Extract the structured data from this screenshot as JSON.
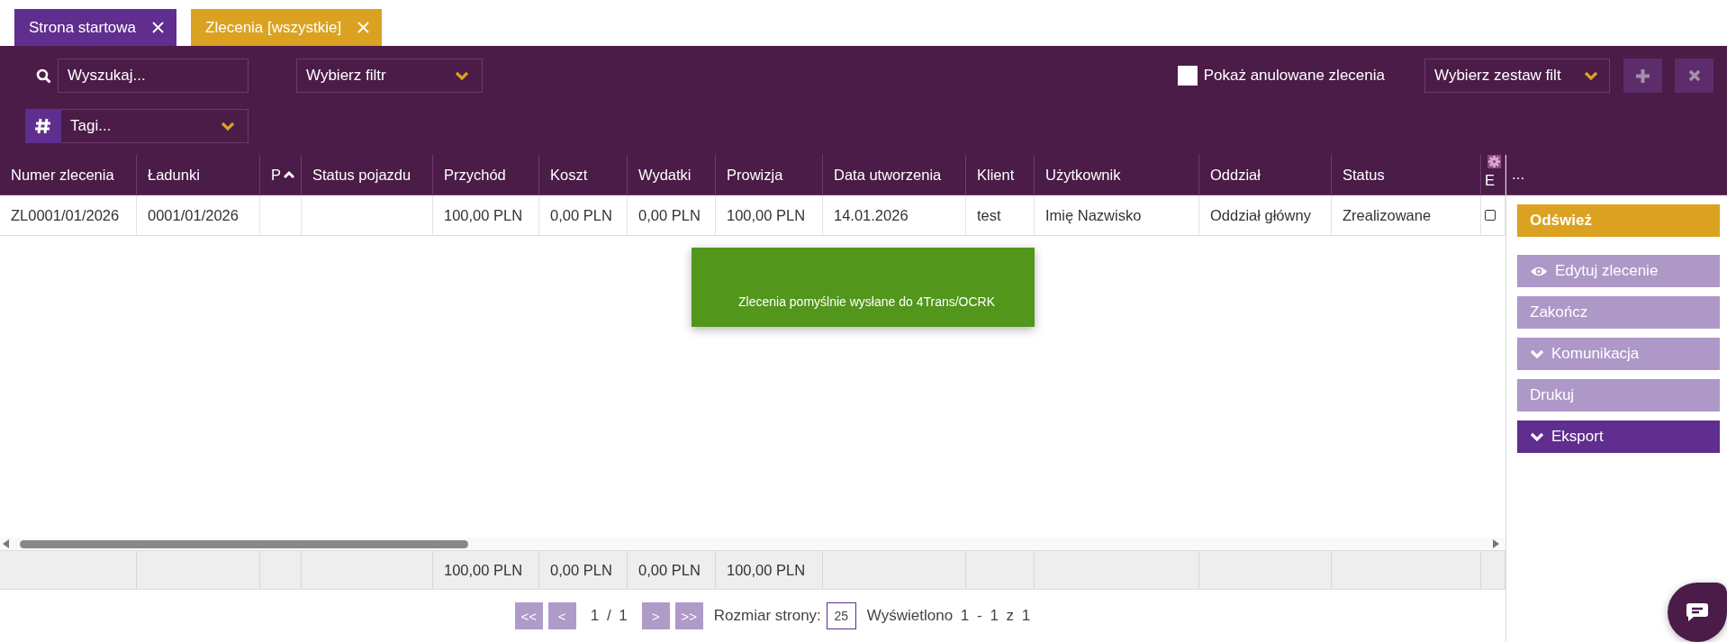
{
  "tabs": [
    {
      "label": "Strona startowa",
      "selected": false
    },
    {
      "label": "Zlecenia [wszystkie]",
      "selected": true
    }
  ],
  "toolbar": {
    "search": {
      "placeholder": "Wyszukaj..."
    },
    "filter": {
      "value": "Wybierz filtr"
    },
    "tags": {
      "placeholder": "Tagi..."
    },
    "show_cancelled": {
      "label": "Pokaż anulowane zlecenia",
      "checked": false
    },
    "filter_set": {
      "value": "Wybierz zestaw filt"
    }
  },
  "table": {
    "columns": [
      {
        "label": "Numer zlecenia",
        "sorted": false
      },
      {
        "label": "Ładunki",
        "sorted": false
      },
      {
        "label": "P",
        "sorted": true
      },
      {
        "label": "Status pojazdu",
        "sorted": false
      },
      {
        "label": "Przychód",
        "sorted": false,
        "total": "100,00 PLN"
      },
      {
        "label": "Koszt",
        "sorted": false,
        "total": "0,00 PLN"
      },
      {
        "label": "Wydatki",
        "sorted": false,
        "total": "0,00 PLN"
      },
      {
        "label": "Prowizja",
        "sorted": false,
        "total": "100,00 PLN"
      },
      {
        "label": "Data utworzenia",
        "sorted": false
      },
      {
        "label": "Klient",
        "sorted": false
      },
      {
        "label": "Użytkownik",
        "sorted": false
      },
      {
        "label": "Oddział",
        "sorted": false
      },
      {
        "label": "Status",
        "sorted": false
      },
      {
        "label": "E",
        "sorted": false
      }
    ],
    "rows": [
      {
        "cells": [
          "ZL0001/01/2026",
          "0001/01/2026",
          "",
          "",
          "100,00 PLN",
          "0,00 PLN",
          "0,00 PLN",
          "100,00 PLN",
          "14.01.2026",
          "test",
          "Imię Nazwisko",
          "Oddział główny",
          "Zrealizowane"
        ],
        "checked": false
      }
    ]
  },
  "toast": {
    "message": "Zlecenia pomyślnie wysłane do 4Trans/OCRK"
  },
  "panel": {
    "header": "...",
    "actions": [
      {
        "label": "Odśwież",
        "kind": "primary"
      },
      {
        "label": "Edytuj zlecenie",
        "kind": "viewer"
      },
      {
        "label": "Zakończ",
        "kind": "plain"
      },
      {
        "label": "Komunikacja",
        "kind": "menu"
      },
      {
        "label": "Drukuj",
        "kind": "plain"
      },
      {
        "label": "Eksport",
        "kind": "export"
      }
    ]
  },
  "pagination": {
    "first": "<<",
    "prev": "<",
    "page": "1 / 1",
    "next": ">",
    "last": ">>",
    "size_label": "Rozmiar strony:",
    "size": "25",
    "summary": "Wyświetlono 1 - 1 z 1"
  }
}
